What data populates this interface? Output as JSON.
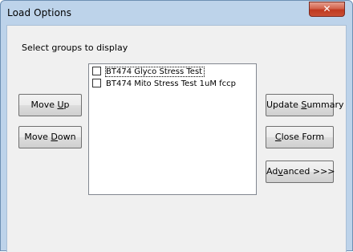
{
  "window": {
    "title": "Load Options",
    "close_glyph": "✕"
  },
  "prompt": "Select groups to display",
  "groups": [
    {
      "label": "BT474 Glyco Stress Test",
      "checked": false
    },
    {
      "label": "BT474 Mito Stress Test 1uM fccp",
      "checked": false
    }
  ],
  "buttons": {
    "move_up": {
      "pre": "Move ",
      "accel": "U",
      "post": "p"
    },
    "move_down": {
      "pre": "Move ",
      "accel": "D",
      "post": "own"
    },
    "update_summary": {
      "pre": "Update ",
      "accel": "S",
      "post": "ummary"
    },
    "close_form": {
      "pre": "",
      "accel": "C",
      "post": "lose Form"
    },
    "advanced": {
      "pre": "Ad",
      "accel": "v",
      "post": "anced >>>"
    }
  }
}
